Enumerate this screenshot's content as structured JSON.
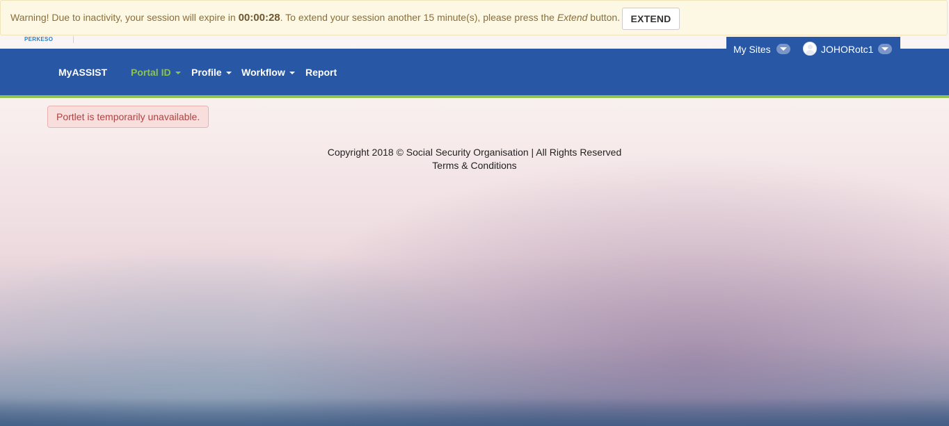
{
  "session_warning": {
    "prefix": "Warning! Due to inactivity, your session will expire in ",
    "countdown": "00:00:28",
    "middle": ". To extend your session another 15 minute(s), please press the ",
    "emphasis": "Extend",
    "suffix": " button.",
    "extend_label": "EXTEND"
  },
  "logo": {
    "text": "PERKESO"
  },
  "nav": {
    "items": [
      {
        "label": "MyASSIST",
        "dropdown": false,
        "active": false
      },
      {
        "label": "Portal ID",
        "dropdown": true,
        "active": true
      },
      {
        "label": "Profile",
        "dropdown": true,
        "active": false
      },
      {
        "label": "Workflow",
        "dropdown": true,
        "active": false
      },
      {
        "label": "Report",
        "dropdown": false,
        "active": false
      }
    ],
    "my_sites": "My Sites",
    "username": "JOHORotc1"
  },
  "alert": {
    "message": "Portlet is temporarily unavailable."
  },
  "footer": {
    "copyright": "Copyright 2018 © Social Security Organisation | All Rights Reserved",
    "terms": "Terms & Conditions"
  },
  "colors": {
    "navbar": "#2858a5",
    "nav_active": "#8dc24f",
    "warning_bg": "#fcf8e3",
    "alert_bg": "#f9dede",
    "alert_text": "#a94442"
  }
}
